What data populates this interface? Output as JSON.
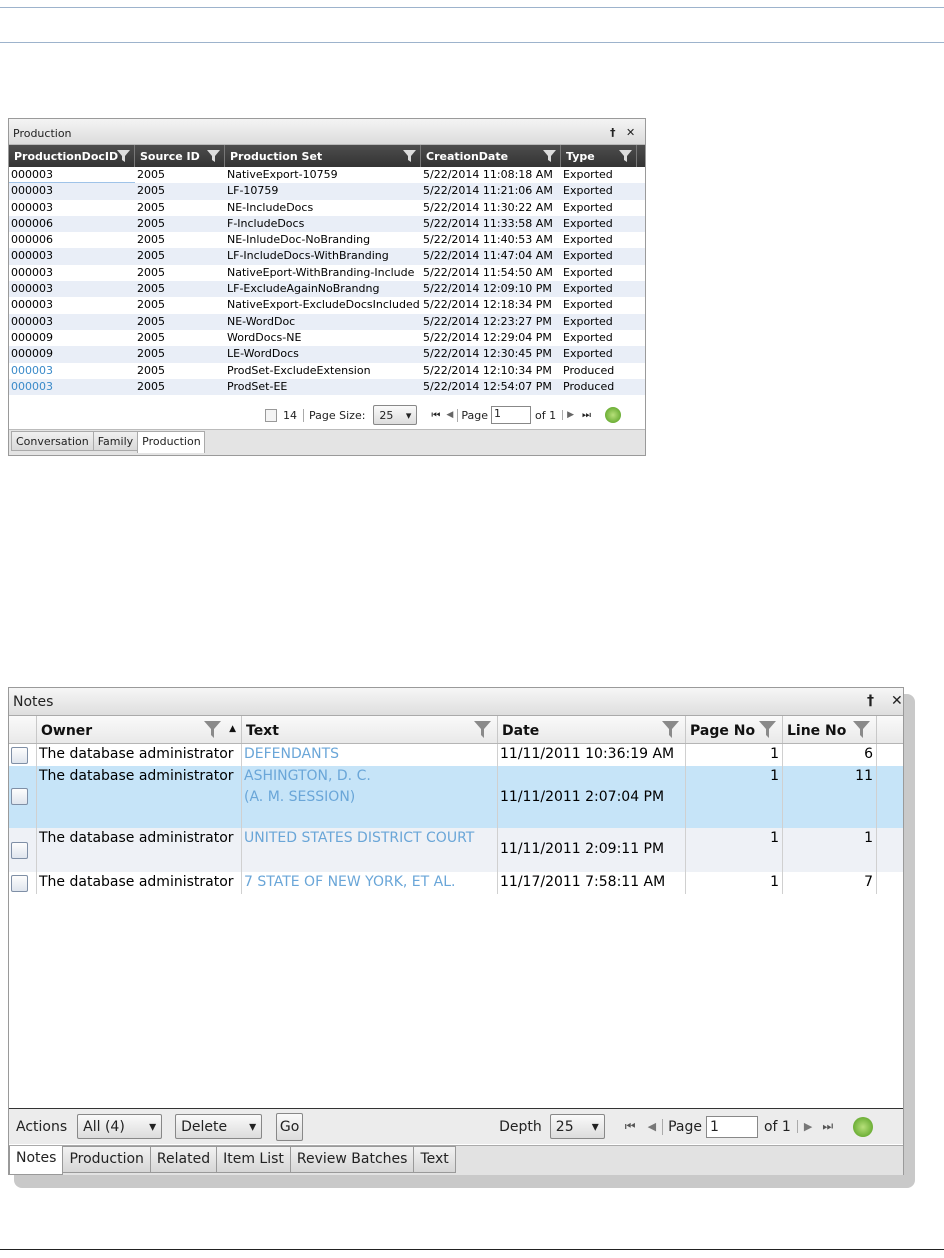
{
  "production": {
    "title": "Production",
    "pin": "†",
    "close": "✕",
    "columns": [
      "ProductionDocID",
      "Source ID",
      "Production Set",
      "CreationDate",
      "Type"
    ],
    "rows": [
      [
        "000003",
        "2005",
        "NativeExport-10759",
        "5/22/2014 11:08:18 AM",
        "Exported"
      ],
      [
        "000003",
        "2005",
        "LF-10759",
        "5/22/2014 11:21:06 AM",
        "Exported"
      ],
      [
        "000003",
        "2005",
        "NE-IncludeDocs",
        "5/22/2014 11:30:22 AM",
        "Exported"
      ],
      [
        "000006",
        "2005",
        "F-IncludeDocs",
        "5/22/2014 11:33:58 AM",
        "Exported"
      ],
      [
        "000006",
        "2005",
        "NE-InludeDoc-NoBranding",
        "5/22/2014 11:40:53 AM",
        "Exported"
      ],
      [
        "000003",
        "2005",
        "LF-IncludeDocs-WithBranding",
        "5/22/2014 11:47:04 AM",
        "Exported"
      ],
      [
        "000003",
        "2005",
        "NativeEport-WithBranding-Include",
        "5/22/2014 11:54:50 AM",
        "Exported"
      ],
      [
        "000003",
        "2005",
        "LF-ExcludeAgainNoBrandng",
        "5/22/2014 12:09:10 PM",
        "Exported"
      ],
      [
        "000003",
        "2005",
        "NativeExport-ExcludeDocsIncluded",
        "5/22/2014 12:18:34 PM",
        "Exported"
      ],
      [
        "000003",
        "2005",
        "NE-WordDoc",
        "5/22/2014 12:23:27 PM",
        "Exported"
      ],
      [
        "000009",
        "2005",
        "WordDocs-NE",
        "5/22/2014 12:29:04 PM",
        "Exported"
      ],
      [
        "000009",
        "2005",
        "LE-WordDocs",
        "5/22/2014 12:30:45 PM",
        "Exported"
      ],
      [
        "000003",
        "2005",
        "ProdSet-ExcludeExtension",
        "5/22/2014 12:10:34 PM",
        "Produced"
      ],
      [
        "000003",
        "2005",
        "ProdSet-EE",
        "5/22/2014 12:54:07 PM",
        "Produced"
      ]
    ],
    "pager": {
      "count": "14",
      "page_size_label": "Page Size:",
      "page_size": "25",
      "page_label": "Page",
      "page": "1",
      "of": "of 1"
    },
    "tabs": [
      "Conversation",
      "Family",
      "Production"
    ]
  },
  "notes": {
    "title": "Notes",
    "pin": "†",
    "close": "✕",
    "columns": [
      "Owner",
      "Text",
      "Date",
      "Page No",
      "Line No"
    ],
    "rows": [
      {
        "owner": "The database administrator",
        "text1": "DEFENDANTS",
        "text2": "",
        "date": "11/11/2011 10:36:19 AM",
        "page": "1",
        "line": "6"
      },
      {
        "owner": "The database administrator",
        "text1": "ASHINGTON, D. C.",
        "text2": "(A. M. SESSION)",
        "date": "11/11/2011 2:07:04 PM",
        "page": "1",
        "line": "11"
      },
      {
        "owner": "The database administrator",
        "text1": "UNITED STATES DISTRICT COURT",
        "text2": "",
        "date": "11/11/2011 2:09:11 PM",
        "page": "1",
        "line": "1"
      },
      {
        "owner": "The database administrator",
        "text1": "7  STATE OF NEW YORK, ET AL.",
        "text2": "",
        "date": "11/17/2011 7:58:11 AM",
        "page": "1",
        "line": "7"
      }
    ],
    "actions": {
      "label": "Actions",
      "filter": "All (4)",
      "action": "Delete",
      "go": "Go",
      "depth_label": "Depth",
      "depth": "25",
      "page_label": "Page",
      "page": "1",
      "of": "of 1"
    },
    "tabs": [
      "Notes",
      "Production",
      "Related",
      "Item List",
      "Review Batches",
      "Text"
    ]
  },
  "colors": {
    "link": "#3a8ac9",
    "note_text": "#6aa6d8",
    "selected_row": "#c6e4f8",
    "alt_row": "#e9eef7"
  }
}
